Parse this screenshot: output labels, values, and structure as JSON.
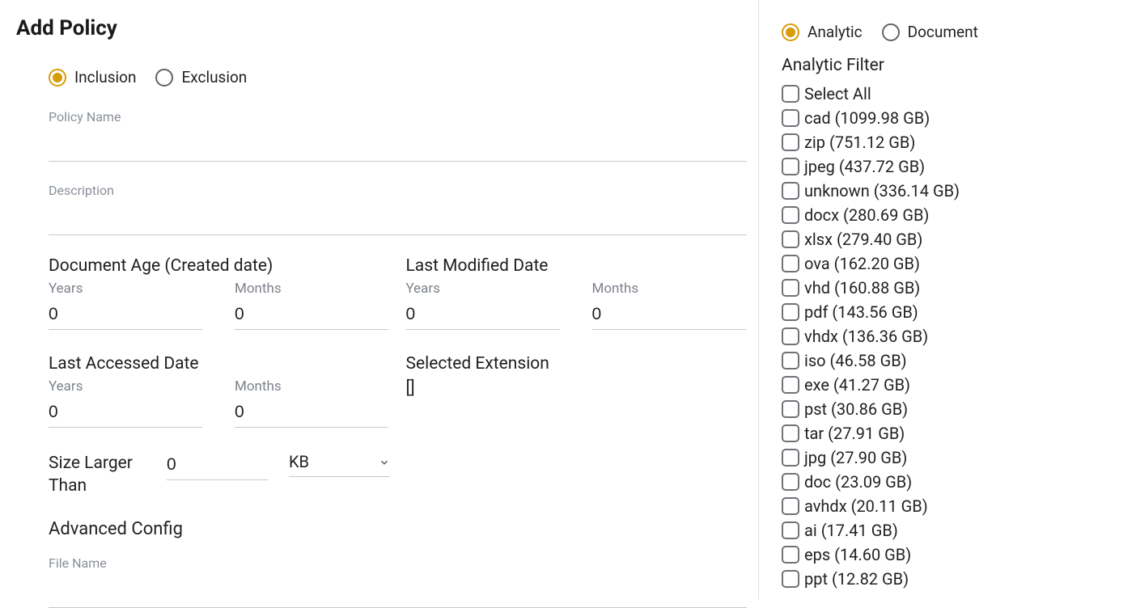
{
  "page": {
    "title": "Add Policy"
  },
  "policyType": {
    "options": [
      {
        "label": "Inclusion",
        "selected": true
      },
      {
        "label": "Exclusion",
        "selected": false
      }
    ]
  },
  "fields": {
    "policyName": {
      "label": "Policy Name",
      "value": ""
    },
    "description": {
      "label": "Description",
      "value": ""
    },
    "docAge": {
      "heading": "Document Age (Created date)",
      "years": {
        "label": "Years",
        "value": "0"
      },
      "months": {
        "label": "Months",
        "value": "0"
      }
    },
    "lastModified": {
      "heading": "Last Modified Date",
      "years": {
        "label": "Years",
        "value": "0"
      },
      "months": {
        "label": "Months",
        "value": "0"
      }
    },
    "lastAccessed": {
      "heading": "Last Accessed Date",
      "years": {
        "label": "Years",
        "value": "0"
      },
      "months": {
        "label": "Months",
        "value": "0"
      }
    },
    "selectedExtension": {
      "heading": "Selected Extension",
      "value": "[]"
    },
    "sizeLargerThan": {
      "label": "Size Larger Than",
      "value": "0",
      "unit": "KB"
    },
    "advanced": {
      "heading": "Advanced Config"
    },
    "fileName": {
      "label": "File Name",
      "value": ""
    }
  },
  "sidebar": {
    "mode": {
      "options": [
        {
          "label": "Analytic",
          "selected": true
        },
        {
          "label": "Document",
          "selected": false
        }
      ]
    },
    "filterTitle": "Analytic Filter",
    "items": [
      {
        "label": "Select All"
      },
      {
        "label": "cad (1099.98 GB)"
      },
      {
        "label": "zip (751.12 GB)"
      },
      {
        "label": "jpeg (437.72 GB)"
      },
      {
        "label": "unknown (336.14 GB)"
      },
      {
        "label": "docx (280.69 GB)"
      },
      {
        "label": "xlsx (279.40 GB)"
      },
      {
        "label": "ova (162.20 GB)"
      },
      {
        "label": "vhd (160.88 GB)"
      },
      {
        "label": "pdf (143.56 GB)"
      },
      {
        "label": "vhdx (136.36 GB)"
      },
      {
        "label": "iso (46.58 GB)"
      },
      {
        "label": "exe (41.27 GB)"
      },
      {
        "label": "pst (30.86 GB)"
      },
      {
        "label": "tar (27.91 GB)"
      },
      {
        "label": "jpg (27.90 GB)"
      },
      {
        "label": "doc (23.09 GB)"
      },
      {
        "label": "avhdx (20.11 GB)"
      },
      {
        "label": "ai (17.41 GB)"
      },
      {
        "label": "eps (14.60 GB)"
      },
      {
        "label": "ppt (12.82 GB)"
      }
    ]
  }
}
